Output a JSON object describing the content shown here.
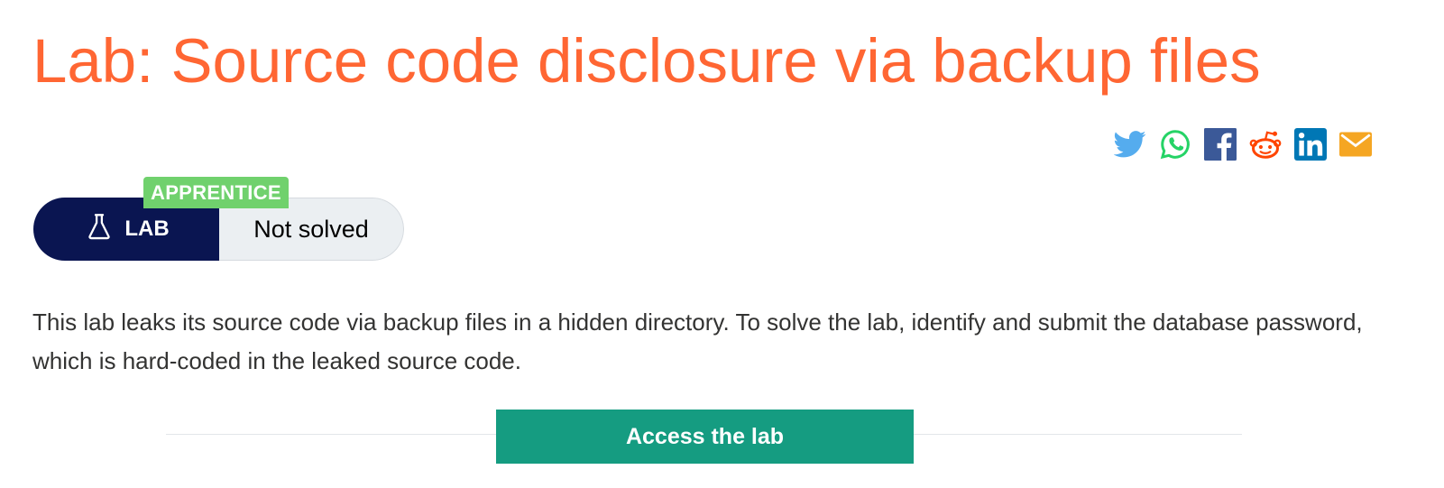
{
  "page": {
    "title": "Lab: Source code disclosure via backup files"
  },
  "share": {
    "icons": [
      "twitter-icon",
      "whatsapp-icon",
      "facebook-icon",
      "reddit-icon",
      "linkedin-icon",
      "email-icon"
    ],
    "colors": {
      "twitter": "#55acee",
      "whatsapp": "#25d366",
      "facebook": "#3b5998",
      "reddit": "#ff4500",
      "linkedin": "#0077b5",
      "email": "#f5a623"
    }
  },
  "lab": {
    "level": "APPRENTICE",
    "tag_label": "LAB",
    "status": "Not solved",
    "description": "This lab leaks its source code via backup files in a hidden directory. To solve the lab, identify and submit the database password, which is hard-coded in the leaked source code.",
    "access_button": "Access the lab"
  },
  "colors": {
    "title": "#ff6633",
    "badge": "#70d16d",
    "lab_tag": "#0a1551",
    "status_bg": "#ebeff2",
    "button": "#159c81"
  }
}
